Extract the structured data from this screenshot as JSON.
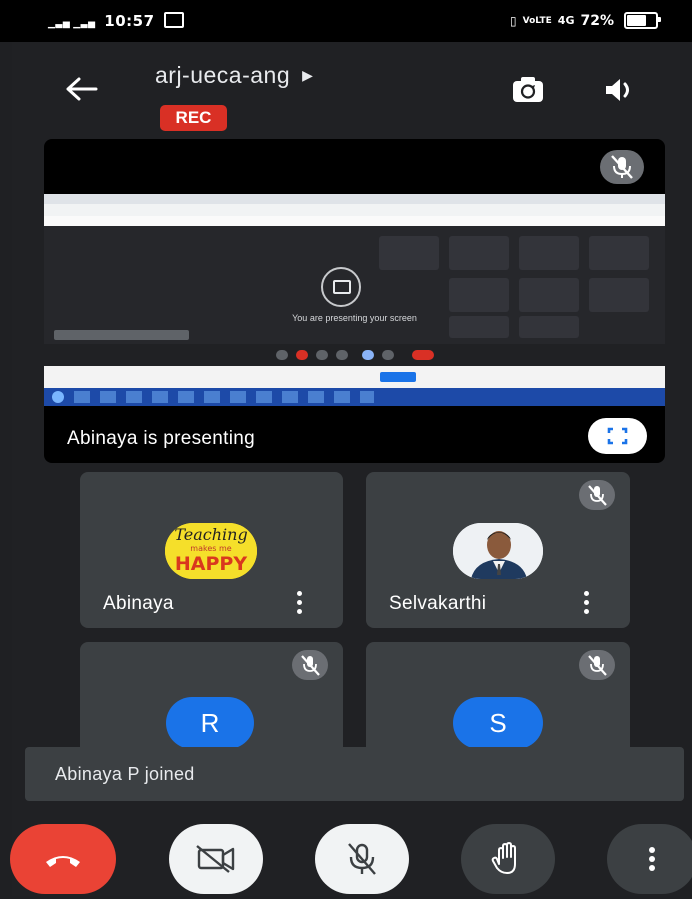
{
  "status_bar": {
    "signal_label": "4G",
    "time": "10:57",
    "network_right": "4G",
    "battery_percent": "72%",
    "battery_level": 0.72
  },
  "header": {
    "meeting_name": "arj-ueca-ang",
    "recording_badge": "REC"
  },
  "presentation": {
    "screen_text": "You are presenting your screen",
    "label": "Abinaya is presenting"
  },
  "participants": [
    {
      "name": "Abinaya",
      "avatar_text": "Teaching makes me HAPPY",
      "muted": false
    },
    {
      "name": "Selvakarthi",
      "avatar_type": "photo",
      "muted": true
    },
    {
      "initial": "R",
      "avatar_color": "#1a73e8",
      "muted": true
    },
    {
      "initial": "S",
      "avatar_color": "#1a73e8",
      "muted": true
    }
  ],
  "toast": {
    "message": "Abinaya P joined"
  },
  "controls": {
    "end_call_color": "#ea4335",
    "icons": [
      "end-call-icon",
      "camera-off-icon",
      "mic-off-icon",
      "raise-hand-icon",
      "more-vert-icon"
    ]
  },
  "colors": {
    "background": "#202124",
    "tile": "#3c4043",
    "rec": "#d93025",
    "accent_blue": "#1a73e8"
  }
}
